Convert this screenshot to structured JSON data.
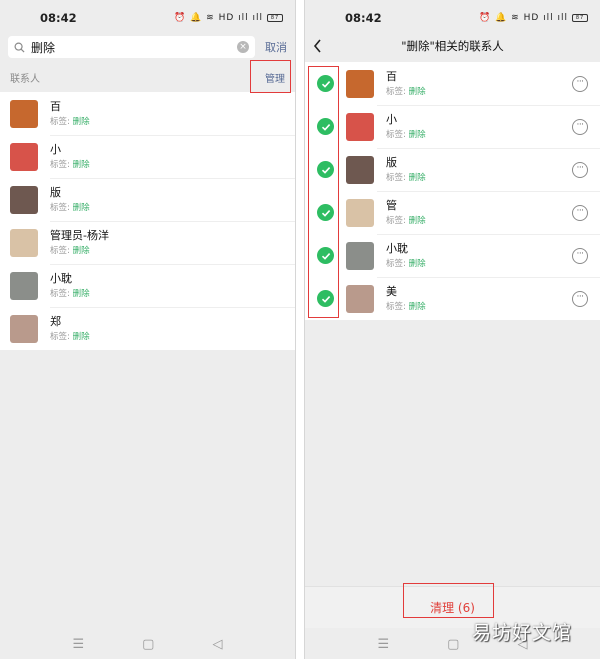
{
  "status": {
    "time": "08:42",
    "icons": "⏰ 🔔 ≋ HD ıll ıll",
    "battery": "87"
  },
  "left": {
    "search": {
      "query": "删除",
      "cancel_label": "取消"
    },
    "section": {
      "title": "联系人",
      "manage_label": "管理"
    },
    "contacts": [
      {
        "name": "百",
        "tag_label": "标签: ",
        "tag_value": "删除",
        "avatar_color": "#c6682e"
      },
      {
        "name": "小",
        "tag_label": "标签: ",
        "tag_value": "删除",
        "avatar_color": "#d7534a"
      },
      {
        "name": "版",
        "tag_label": "标签: ",
        "tag_value": "删除",
        "avatar_color": "#6e5850"
      },
      {
        "name": "管理员-杨洋",
        "tag_label": "标签: ",
        "tag_value": "删除",
        "avatar_color": "#d9c2a6"
      },
      {
        "name": "小耽",
        "tag_label": "标签: ",
        "tag_value": "删除",
        "avatar_color": "#8b8e8a"
      },
      {
        "name": "郑",
        "tag_label": "标签: ",
        "tag_value": "删除",
        "avatar_color": "#b99a8c"
      }
    ]
  },
  "right": {
    "title": "\"删除\"相关的联系人",
    "contacts": [
      {
        "name": "百",
        "tag_label": "标签: ",
        "tag_value": "删除",
        "avatar_color": "#c6682e",
        "checked": true
      },
      {
        "name": "小",
        "tag_label": "标签: ",
        "tag_value": "删除",
        "avatar_color": "#d7534a",
        "checked": true
      },
      {
        "name": "版",
        "tag_label": "标签: ",
        "tag_value": "删除",
        "avatar_color": "#6e5850",
        "checked": true
      },
      {
        "name": "管",
        "tag_label": "标签: ",
        "tag_value": "删除",
        "avatar_color": "#d9c2a6",
        "checked": true
      },
      {
        "name": "小耽",
        "tag_label": "标签: ",
        "tag_value": "删除",
        "avatar_color": "#8b8e8a",
        "checked": true
      },
      {
        "name": "美",
        "tag_label": "标签: ",
        "tag_value": "删除",
        "avatar_color": "#b99a8c",
        "checked": true
      }
    ],
    "cleanup_label": "清理 (6)"
  },
  "sysnav": {
    "menu": "☰",
    "home": "▢",
    "back": "◁"
  },
  "watermark": "易坊好文馆",
  "colors": {
    "accent_green": "#2ebd62",
    "link_blue": "#586b95",
    "highlight_red": "#e23b3b"
  }
}
